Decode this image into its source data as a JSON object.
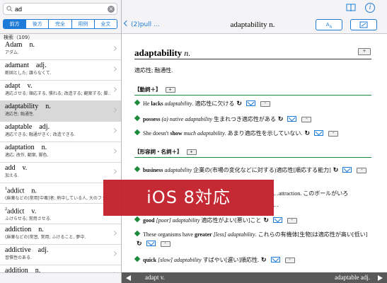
{
  "colors": {
    "accent": "#1e7bd7",
    "section_rule": "#1e8a3c",
    "banner": "#c11d29",
    "bottom_bar": "#595959"
  },
  "search": {
    "value": "ad"
  },
  "segments": [
    {
      "label": "前方",
      "selected": true
    },
    {
      "label": "後方",
      "selected": false
    },
    {
      "label": "完全",
      "selected": false
    },
    {
      "label": "用例",
      "selected": false
    },
    {
      "label": "全文",
      "selected": false
    }
  ],
  "count_label": "検索（109）",
  "words": [
    {
      "head": "Adam　n.",
      "def": "アダム."
    },
    {
      "head": "adamant　adj.",
      "def": "断固とした; 譲らなくて."
    },
    {
      "head": "adapt　v.",
      "def": "適応させる; 順応する, 慣れる; 改造する; 翻案する; 脚…"
    },
    {
      "head": "adaptability　n.",
      "def": "適応性; 融通性."
    },
    {
      "head": "adaptable　adj.",
      "def": "適応できる; 融通がきく; 改造できる."
    },
    {
      "head": "adaptation　n.",
      "def": "適応; 改作, 翻案, 脚色."
    },
    {
      "head": "add　v.",
      "def": "加える."
    },
    {
      "sup": "1",
      "head": "addict　n.",
      "def": "(麻薬などの)常用[中毒]者; 熱中している人, 大のファン"
    },
    {
      "sup": "2",
      "head": "addict　v.",
      "def": "ふけらせる; 常用させる."
    },
    {
      "head": "addiction　n.",
      "def": "(麻薬などの)常習, 常用; ふけること, 夢中."
    },
    {
      "head": "addictive　adj.",
      "def": "習慣性のある."
    },
    {
      "head": "addition　n.",
      "def": "付加, 追加; 足し算; 建て増し."
    }
  ],
  "nav": {
    "back_label": "(2)pull ...",
    "title": "adaptability n.",
    "font_button": "A",
    "font_button_sub": "A",
    "info_label": "i"
  },
  "entry": {
    "headword": "adaptability",
    "pos": "n.",
    "gloss": "適応性; 融通性.",
    "add_label": "+",
    "sections": [
      {
        "label": "【動詞＋】"
      },
      {
        "label": "【形容詞・名詞＋】"
      }
    ],
    "examples": [
      {
        "pre": "He ",
        "kw": "lacks",
        "mid": " adaptability",
        "post": ". 適応性に欠ける"
      },
      {
        "pre": "",
        "kw": "possess",
        "mid": " (a) native adaptability",
        "post": " 生まれつき適応性がある"
      },
      {
        "pre": "She doesn't ",
        "kw": "show",
        "mid": " much adaptability",
        "post": ". あまり適応性を示していない."
      },
      {
        "pre": "",
        "kw": "business",
        "mid": " adaptability",
        "post": " 企業の(市場の変化などに対する)適応性[順応する能力]"
      },
      {
        "pre": "",
        "kw": "",
        "mid": "",
        "post": "…attraction. このボールがいろ"
      },
      {
        "pre": "",
        "kw": "",
        "mid": "",
        "post": "…"
      },
      {
        "pre": "",
        "kw": "good",
        "mid": " [poor] adaptability",
        "post": " 適応性がよい[悪い]こと"
      },
      {
        "pre": "These organisms have ",
        "kw": "greater",
        "mid": " [less] adaptability",
        "post": ". これらの有機体[生物]は適応性が高い[低い]"
      },
      {
        "pre": "",
        "kw": "quick",
        "mid": " [slow] adaptability",
        "post": " すばやい[遅い]順応性."
      }
    ]
  },
  "bottom": {
    "prev": "adapt v.",
    "next": "adaptable adj."
  },
  "banner": "iOS 8対応"
}
